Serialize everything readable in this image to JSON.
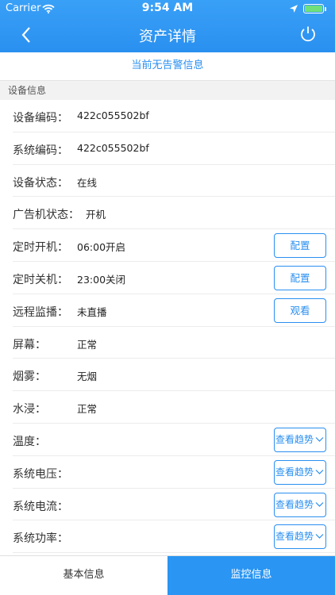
{
  "status_bar": {
    "carrier": "Carrier",
    "time": "9:54 AM"
  },
  "header": {
    "title": "资产详情"
  },
  "alert_text": "当前无告警信息",
  "section_title": "设备信息",
  "rows": [
    {
      "label": "设备编码：",
      "value": "422c055502bf"
    },
    {
      "label": "系统编码：",
      "value": "422c055502bf"
    },
    {
      "label": "设备状态：",
      "value": "在线"
    },
    {
      "label": "广告机状态：",
      "value": "开机"
    },
    {
      "label": "定时开机：",
      "value": "06:00开启",
      "button": "配置"
    },
    {
      "label": "定时关机：",
      "value": "23:00关闭",
      "button": "配置"
    },
    {
      "label": "远程监播：",
      "value": "未直播",
      "button": "观看"
    },
    {
      "label": "屏幕：",
      "value": "正常"
    },
    {
      "label": "烟雾：",
      "value": "无烟"
    },
    {
      "label": "水浸：",
      "value": "正常"
    },
    {
      "label": "温度：",
      "trend": "查看趋势"
    },
    {
      "label": "系统电压：",
      "trend": "查看趋势"
    },
    {
      "label": "系统电流：",
      "trend": "查看趋势"
    },
    {
      "label": "系统功率：",
      "trend": "查看趋势"
    }
  ],
  "tabs": {
    "basic": "基本信息",
    "monitor": "监控信息"
  },
  "colors": {
    "accent": "#2a8ff0",
    "header": "#39a0f7",
    "battery": "#6fe07a"
  },
  "icons": {
    "back": "chevron-left-icon",
    "power": "power-icon",
    "wifi": "wifi-icon",
    "location": "location-arrow-icon",
    "battery": "battery-icon"
  }
}
